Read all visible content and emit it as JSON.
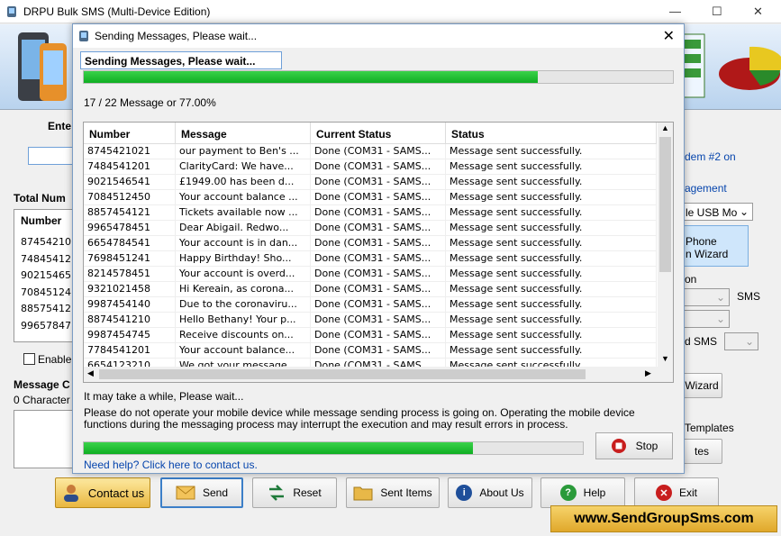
{
  "window": {
    "title": "DRPU Bulk SMS (Multi-Device Edition)",
    "minimize": "—",
    "maximize": "☐",
    "close": "✕"
  },
  "background": {
    "enter_label": "Ente",
    "total_num_label": "Total Num",
    "number_col": "Number",
    "numbers": [
      "87454210",
      "74845412",
      "90215465",
      "70845124",
      "88575412",
      "99657847"
    ],
    "enable_label": "Enable",
    "message_label": "Message C",
    "characters_label": "0 Character",
    "modem_text": "dem #2 on",
    "management_text": "agement",
    "usb_select": "le USB Mo",
    "iphone_line1": "Phone",
    "iphone_line2": "n  Wizard",
    "on_text": "on",
    "sms_text": "SMS",
    "d_sms_text": "d SMS",
    "wizard_btn": "Wizard",
    "templates_text": "Templates",
    "tes_btn": "tes"
  },
  "dialog": {
    "title": "Sending Messages, Please wait...",
    "header_label": "Sending Messages, Please wait...",
    "top_progress": 0.77,
    "count_text": "17 / 22 Message or 77.00%",
    "columns": [
      "Number",
      "Message",
      "Current Status",
      "Status"
    ],
    "rows": [
      [
        "8745421021",
        "our payment to Ben's ...",
        "Done (COM31 - SAMS...",
        "Message sent successfully."
      ],
      [
        "7484541201",
        "ClarityCard: We have...",
        "Done (COM31 - SAMS...",
        "Message sent successfully."
      ],
      [
        "9021546541",
        "£1949.00 has been d...",
        "Done (COM31 - SAMS...",
        "Message sent successfully."
      ],
      [
        "7084512450",
        "Your account balance ...",
        "Done (COM31 - SAMS...",
        "Message sent successfully."
      ],
      [
        "8857454121",
        "Tickets available now ...",
        "Done (COM31 - SAMS...",
        "Message sent successfully."
      ],
      [
        "9965478451",
        " Dear Abigail. Redwo...",
        "Done (COM31 - SAMS...",
        "Message sent successfully."
      ],
      [
        "6654784541",
        "Your account is in dan...",
        "Done (COM31 - SAMS...",
        "Message sent successfully."
      ],
      [
        "7698451241",
        "Happy Birthday! Sho...",
        "Done (COM31 - SAMS...",
        "Message sent successfully."
      ],
      [
        "8214578451",
        "Your account is overd...",
        "Done (COM31 - SAMS...",
        "Message sent successfully."
      ],
      [
        "9321021458",
        "Hi Kereain, as corona...",
        "Done (COM31 - SAMS...",
        "Message sent successfully."
      ],
      [
        "9987454140",
        "Due to the coronaviru...",
        "Done (COM31 - SAMS...",
        "Message sent successfully."
      ],
      [
        "8874541210",
        "Hello Bethany! Your p...",
        "Done (COM31 - SAMS...",
        "Message sent successfully."
      ],
      [
        "9987454745",
        "Receive discounts on...",
        "Done (COM31 - SAMS...",
        "Message sent successfully."
      ],
      [
        "7784541201",
        "Your account balance...",
        "Done (COM31 - SAMS...",
        "Message sent successfully."
      ],
      [
        "6654123210",
        "We got your message...",
        "Done (COM31 - SAMS...",
        "Message sent successfully."
      ]
    ],
    "wait_text": "It may take a while, Please wait...",
    "warning_text": "Please do not operate your mobile device while message sending process is going on. Operating the mobile device functions during the messaging process may interrupt the execution and may result errors in process.",
    "bottom_progress": 0.78,
    "stop_label": "Stop",
    "help_link": "Need help? Click here to contact us."
  },
  "toolbar": {
    "contact": "Contact us",
    "send": "Send",
    "reset": "Reset",
    "sent_items": "Sent Items",
    "about": "About Us",
    "help": "Help",
    "exit": "Exit"
  },
  "brand": "www.SendGroupSms.com"
}
